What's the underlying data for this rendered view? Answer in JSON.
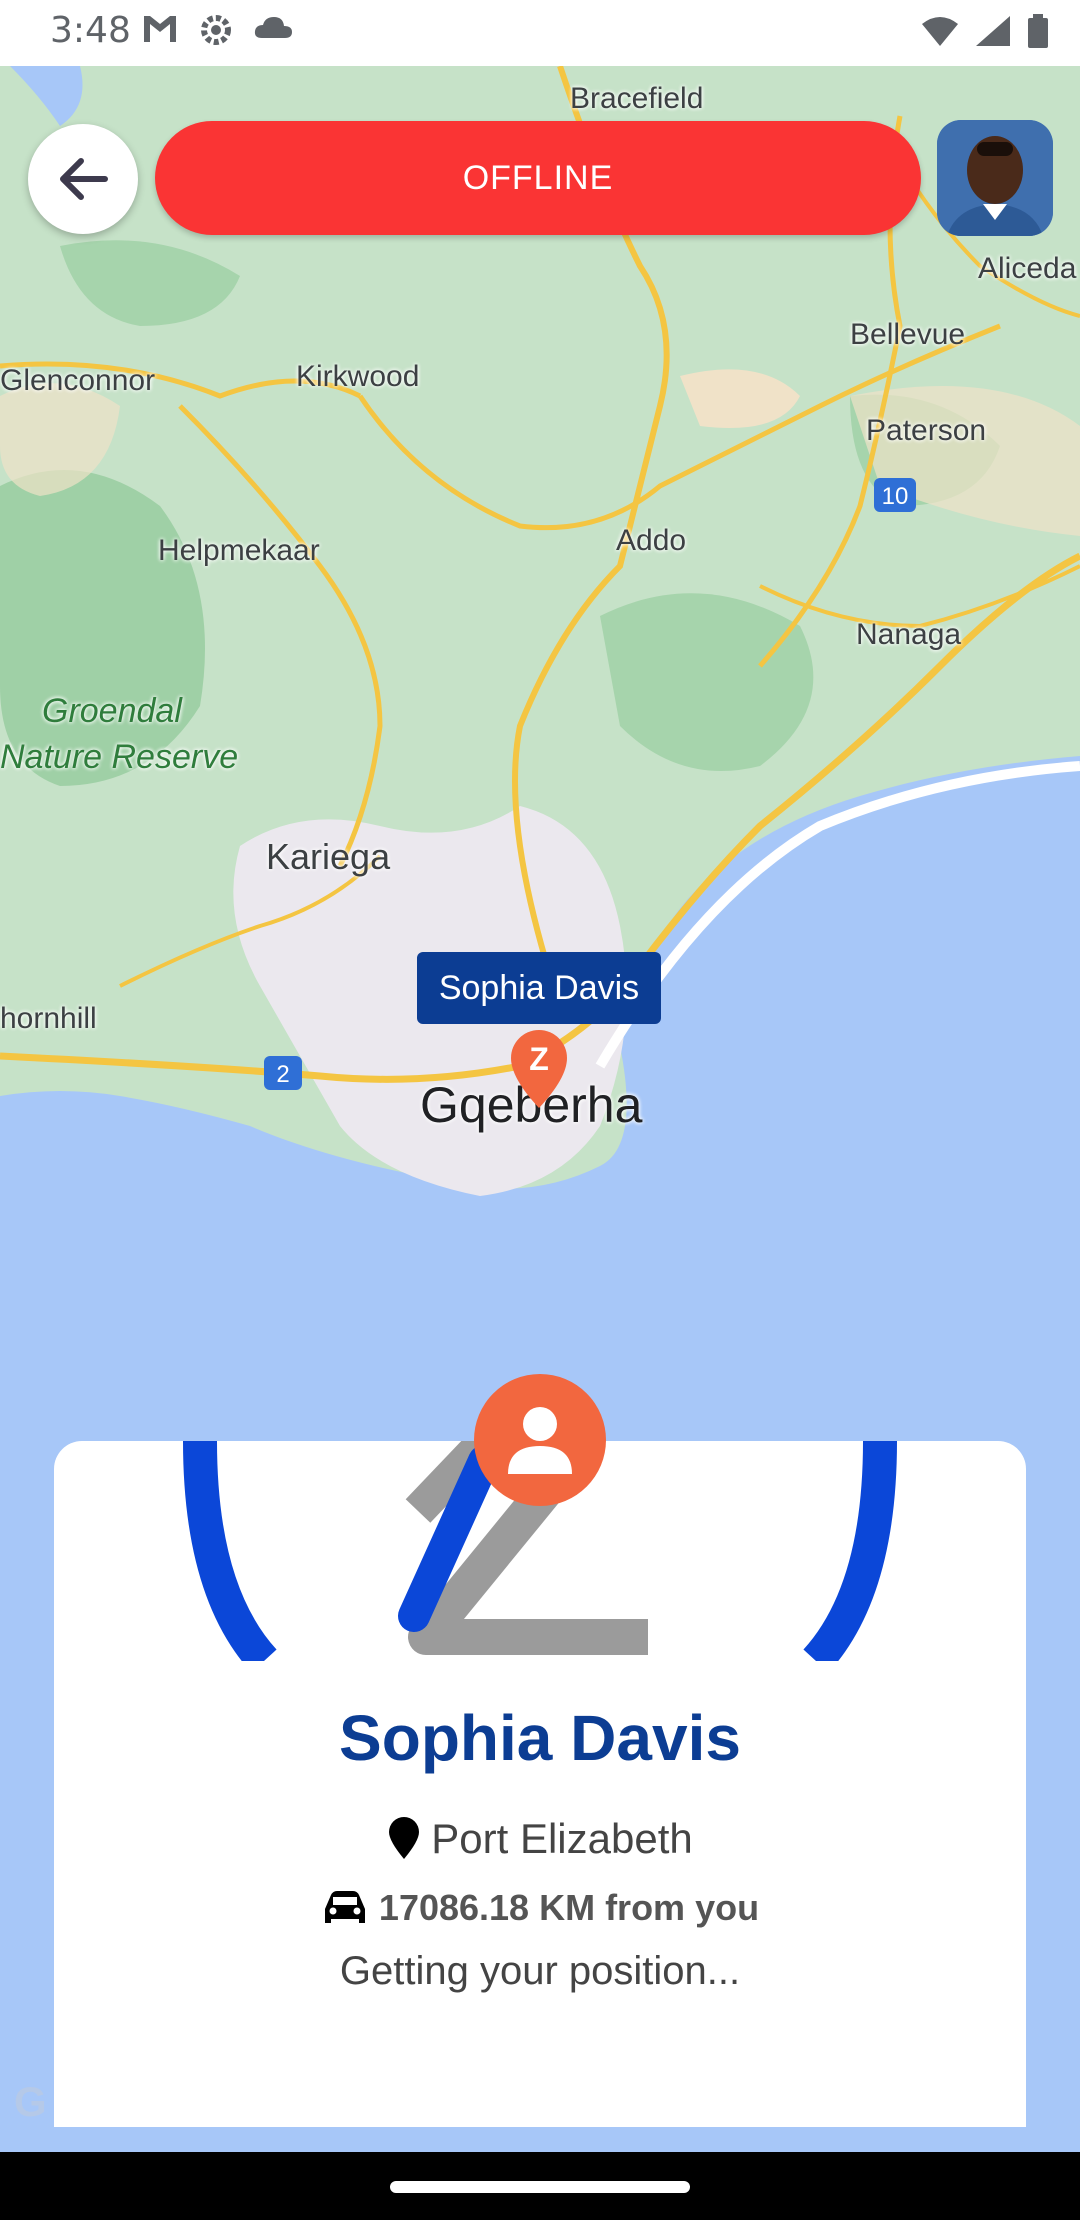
{
  "status_bar": {
    "time": "3:48",
    "left_icons": [
      "gmail-icon",
      "settings-gear-icon",
      "cloud-icon"
    ],
    "right_icons": [
      "wifi-icon",
      "signal-icon",
      "battery-icon"
    ]
  },
  "header": {
    "back_icon": "arrow-left-icon",
    "status_button_label": "OFFLINE",
    "status_button_color": "#fa3434"
  },
  "map": {
    "water_color": "#a7c7f8",
    "land_color": "#c6e2c8",
    "labels": [
      "Bracefield",
      "Aliceda",
      "Bellevue",
      "Glenconnor",
      "Kirkwood",
      "Paterson",
      "Helpmekaar",
      "Addo",
      "Nanaga",
      "Groendal",
      "Nature Reserve",
      "Kariega",
      "hornhill",
      "Gqeberha"
    ],
    "road_shields": [
      "10",
      "2"
    ],
    "pin_callout": "Sophia Davis",
    "pin_logo": "Z"
  },
  "driver_card": {
    "name": "Sophia Davis",
    "city": "Port Elizabeth",
    "distance": "17086.18 KM from you",
    "status": "Getting your position...",
    "brand_color": "#0c3d93",
    "profile_icon": "person-icon",
    "pin_icon": "location-pin-icon",
    "car_icon": "car-icon"
  },
  "watermark": "G"
}
